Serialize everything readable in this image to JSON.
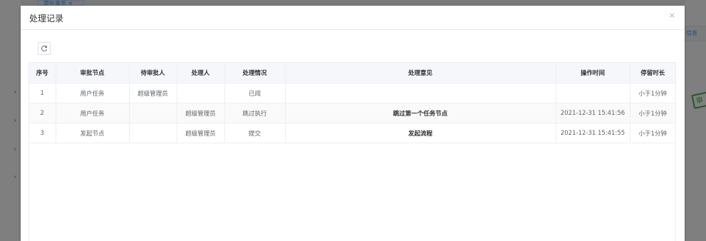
{
  "background": {
    "tag_label": "审批事务 ×",
    "right_link": "信息",
    "stamp_text": "审"
  },
  "dialog": {
    "title": "处理记录",
    "close_label": "×",
    "refresh_icon": "refresh-icon"
  },
  "table": {
    "headers": [
      "序号",
      "审批节点",
      "待审批人",
      "处理人",
      "处理情况",
      "处理意见",
      "操作时间",
      "停留时长"
    ],
    "rows": [
      [
        "1",
        "用户任务",
        "超级管理员",
        "",
        "已阅",
        "",
        "",
        "小于1分钟"
      ],
      [
        "2",
        "用户任务",
        "",
        "超级管理员",
        "跳过执行",
        "跳过第一个任务节点",
        "2021-12-31 15:41:56",
        "小于1分钟"
      ],
      [
        "3",
        "发起节点",
        "",
        "超级管理员",
        "提交",
        "发起流程",
        "2021-12-31 15:41:55",
        "小于1分钟"
      ]
    ]
  }
}
